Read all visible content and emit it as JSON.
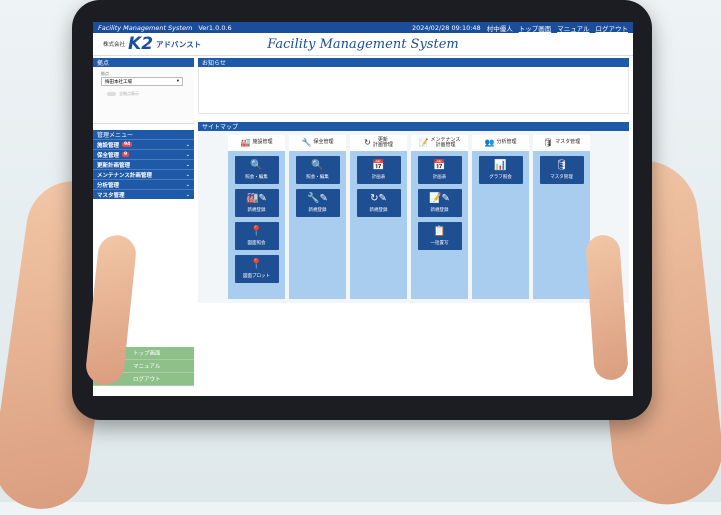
{
  "topbar": {
    "app_title": "Facility Management System",
    "version": "Ver1.0.0.6",
    "datetime": "2024/02/28 09:10:48",
    "user": "村中優人",
    "links": [
      "トップ画面",
      "マニュアル",
      "ログアウト"
    ]
  },
  "header": {
    "company": "株式会社",
    "logo_text": "K2",
    "logo_suffix": "アドバンスト",
    "system_title": "Facility Management System"
  },
  "sidebar": {
    "base_header": "拠点",
    "base_label": "拠点",
    "base_value": "梅田本社工場",
    "toggle_label": "全拠点表示",
    "menu_header": "管理メニュー",
    "menu_items": [
      {
        "label": "施設管理",
        "badge": "94"
      },
      {
        "label": "保全管理",
        "badge": "9"
      },
      {
        "label": "更新計画管理",
        "badge": ""
      },
      {
        "label": "メンテナンス計画管理",
        "badge": ""
      },
      {
        "label": "分析管理",
        "badge": ""
      },
      {
        "label": "マスタ管理",
        "badge": ""
      }
    ],
    "quick_links": [
      "トップ画面",
      "マニュアル",
      "ログアウト"
    ]
  },
  "main": {
    "notice_header": "お知らせ",
    "sitemap_header": "サイトマップ",
    "columns": [
      {
        "title": "施設管理",
        "icon": "factory-icon",
        "tiles": [
          {
            "label": "照会・編集",
            "icon": "search-icon"
          },
          {
            "label": "新規登録",
            "icon": "factory-edit-icon"
          },
          {
            "label": "図面照会",
            "icon": "map-pin-icon"
          },
          {
            "label": "図面プロット",
            "icon": "map-pin-icon"
          }
        ]
      },
      {
        "title": "保全管理",
        "icon": "wrench-icon",
        "tiles": [
          {
            "label": "照会・編集",
            "icon": "search-icon"
          },
          {
            "label": "新規登録",
            "icon": "wrench-edit-icon"
          }
        ]
      },
      {
        "title": "更新\n計画管理",
        "icon": "refresh-icon",
        "tiles": [
          {
            "label": "計画表",
            "icon": "calendar-icon"
          },
          {
            "label": "新規登録",
            "icon": "refresh-edit-icon"
          }
        ]
      },
      {
        "title": "メンテナンス\n計画管理",
        "icon": "checklist-icon",
        "tiles": [
          {
            "label": "計画表",
            "icon": "calendar-icon"
          },
          {
            "label": "新規登録",
            "icon": "checklist-edit-icon"
          },
          {
            "label": "一括置写",
            "icon": "copy-icon"
          }
        ]
      },
      {
        "title": "分析管理",
        "icon": "analysis-icon",
        "tiles": [
          {
            "label": "グラフ照会",
            "icon": "bar-chart-icon"
          }
        ]
      },
      {
        "title": "マスタ管理",
        "icon": "database-icon",
        "tiles": [
          {
            "label": "マスタ管理",
            "icon": "database-icon"
          }
        ]
      }
    ]
  },
  "colors": {
    "brand_blue": "#1b4e9a",
    "menu_blue": "#1f5aa8",
    "tile_blue": "#1e4f92",
    "column_bg": "#a9cdee",
    "badge_red": "#e9445a",
    "quick_green": "#8ec08a"
  }
}
